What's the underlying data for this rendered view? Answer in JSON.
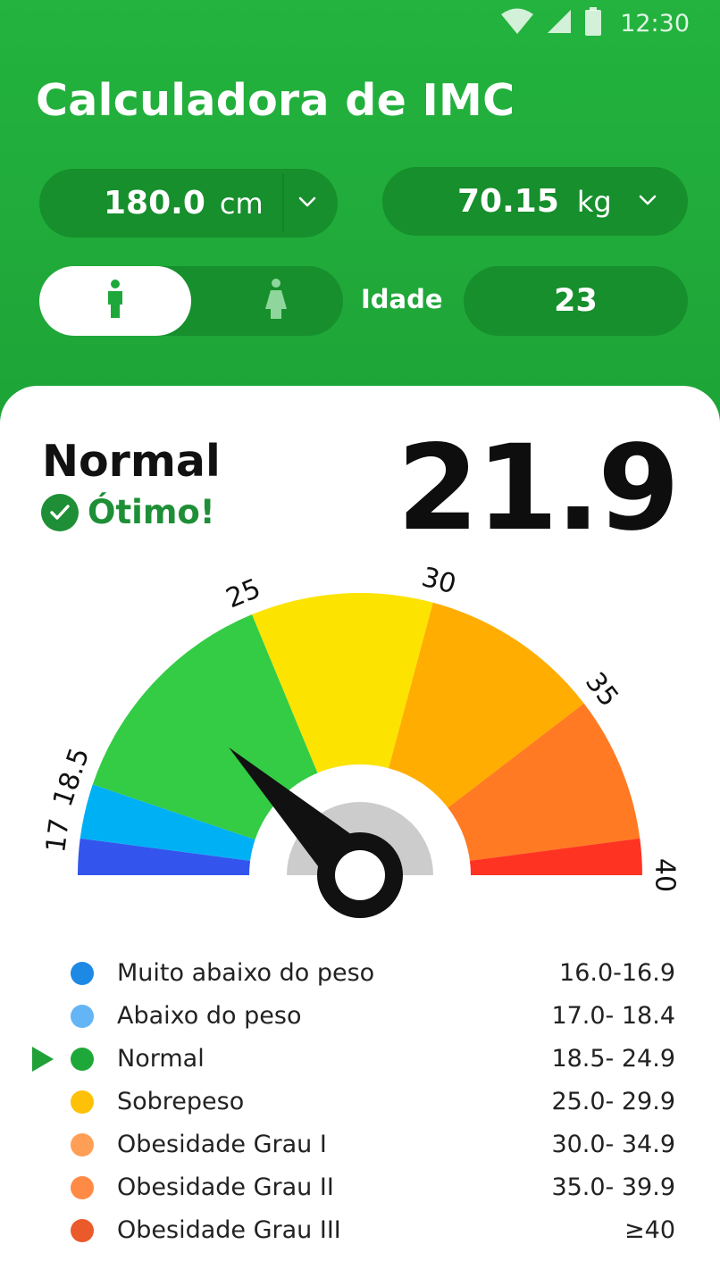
{
  "status_bar": {
    "time": "12:30"
  },
  "app": {
    "title": "Calculadora de IMC"
  },
  "inputs": {
    "height": {
      "value": "180.0",
      "unit": "cm"
    },
    "weight": {
      "value": "70.15",
      "unit": "kg"
    },
    "gender": {
      "selected": "male"
    },
    "age_label": "Idade",
    "age_value": "23"
  },
  "result": {
    "category": "Normal",
    "status": "Ótimo!",
    "bmi": "21.9",
    "bmi_value": 21.9
  },
  "gauge": {
    "min": 16,
    "max": 40,
    "tick_labels": [
      "17",
      "18.5",
      "25",
      "30",
      "35",
      "40"
    ],
    "segments": [
      {
        "from": 16,
        "to": 17,
        "color": "#3355ee"
      },
      {
        "from": 17,
        "to": 18.5,
        "color": "#00b0f5"
      },
      {
        "from": 18.5,
        "to": 25,
        "color": "#33cc44"
      },
      {
        "from": 25,
        "to": 30,
        "color": "#fce300"
      },
      {
        "from": 30,
        "to": 35,
        "color": "#ffad00"
      },
      {
        "from": 35,
        "to": 39,
        "color": "#ff7a22"
      },
      {
        "from": 39,
        "to": 40,
        "color": "#ff3322"
      }
    ]
  },
  "legend": [
    {
      "label": "Muito abaixo do peso",
      "range": "16.0-16.9",
      "color": "#1e88e5",
      "active": false
    },
    {
      "label": "Abaixo do peso",
      "range": "17.0- 18.4",
      "color": "#64b5f6",
      "active": false
    },
    {
      "label": "Normal",
      "range": "18.5- 24.9",
      "color": "#1fa83a",
      "active": true
    },
    {
      "label": "Sobrepeso",
      "range": "25.0- 29.9",
      "color": "#ffc107",
      "active": false
    },
    {
      "label": "Obesidade Grau I",
      "range": "30.0- 34.9",
      "color": "#ff9f55",
      "active": false
    },
    {
      "label": "Obesidade Grau II",
      "range": "35.0- 39.9",
      "color": "#ff8a45",
      "active": false
    },
    {
      "label": "Obesidade Grau III",
      "range": "≥40",
      "color": "#ea5a2a",
      "active": false
    }
  ],
  "colors": {
    "primary": "#21a83b",
    "primary_dark": "#168f2c",
    "status_green": "#1e8f36"
  }
}
